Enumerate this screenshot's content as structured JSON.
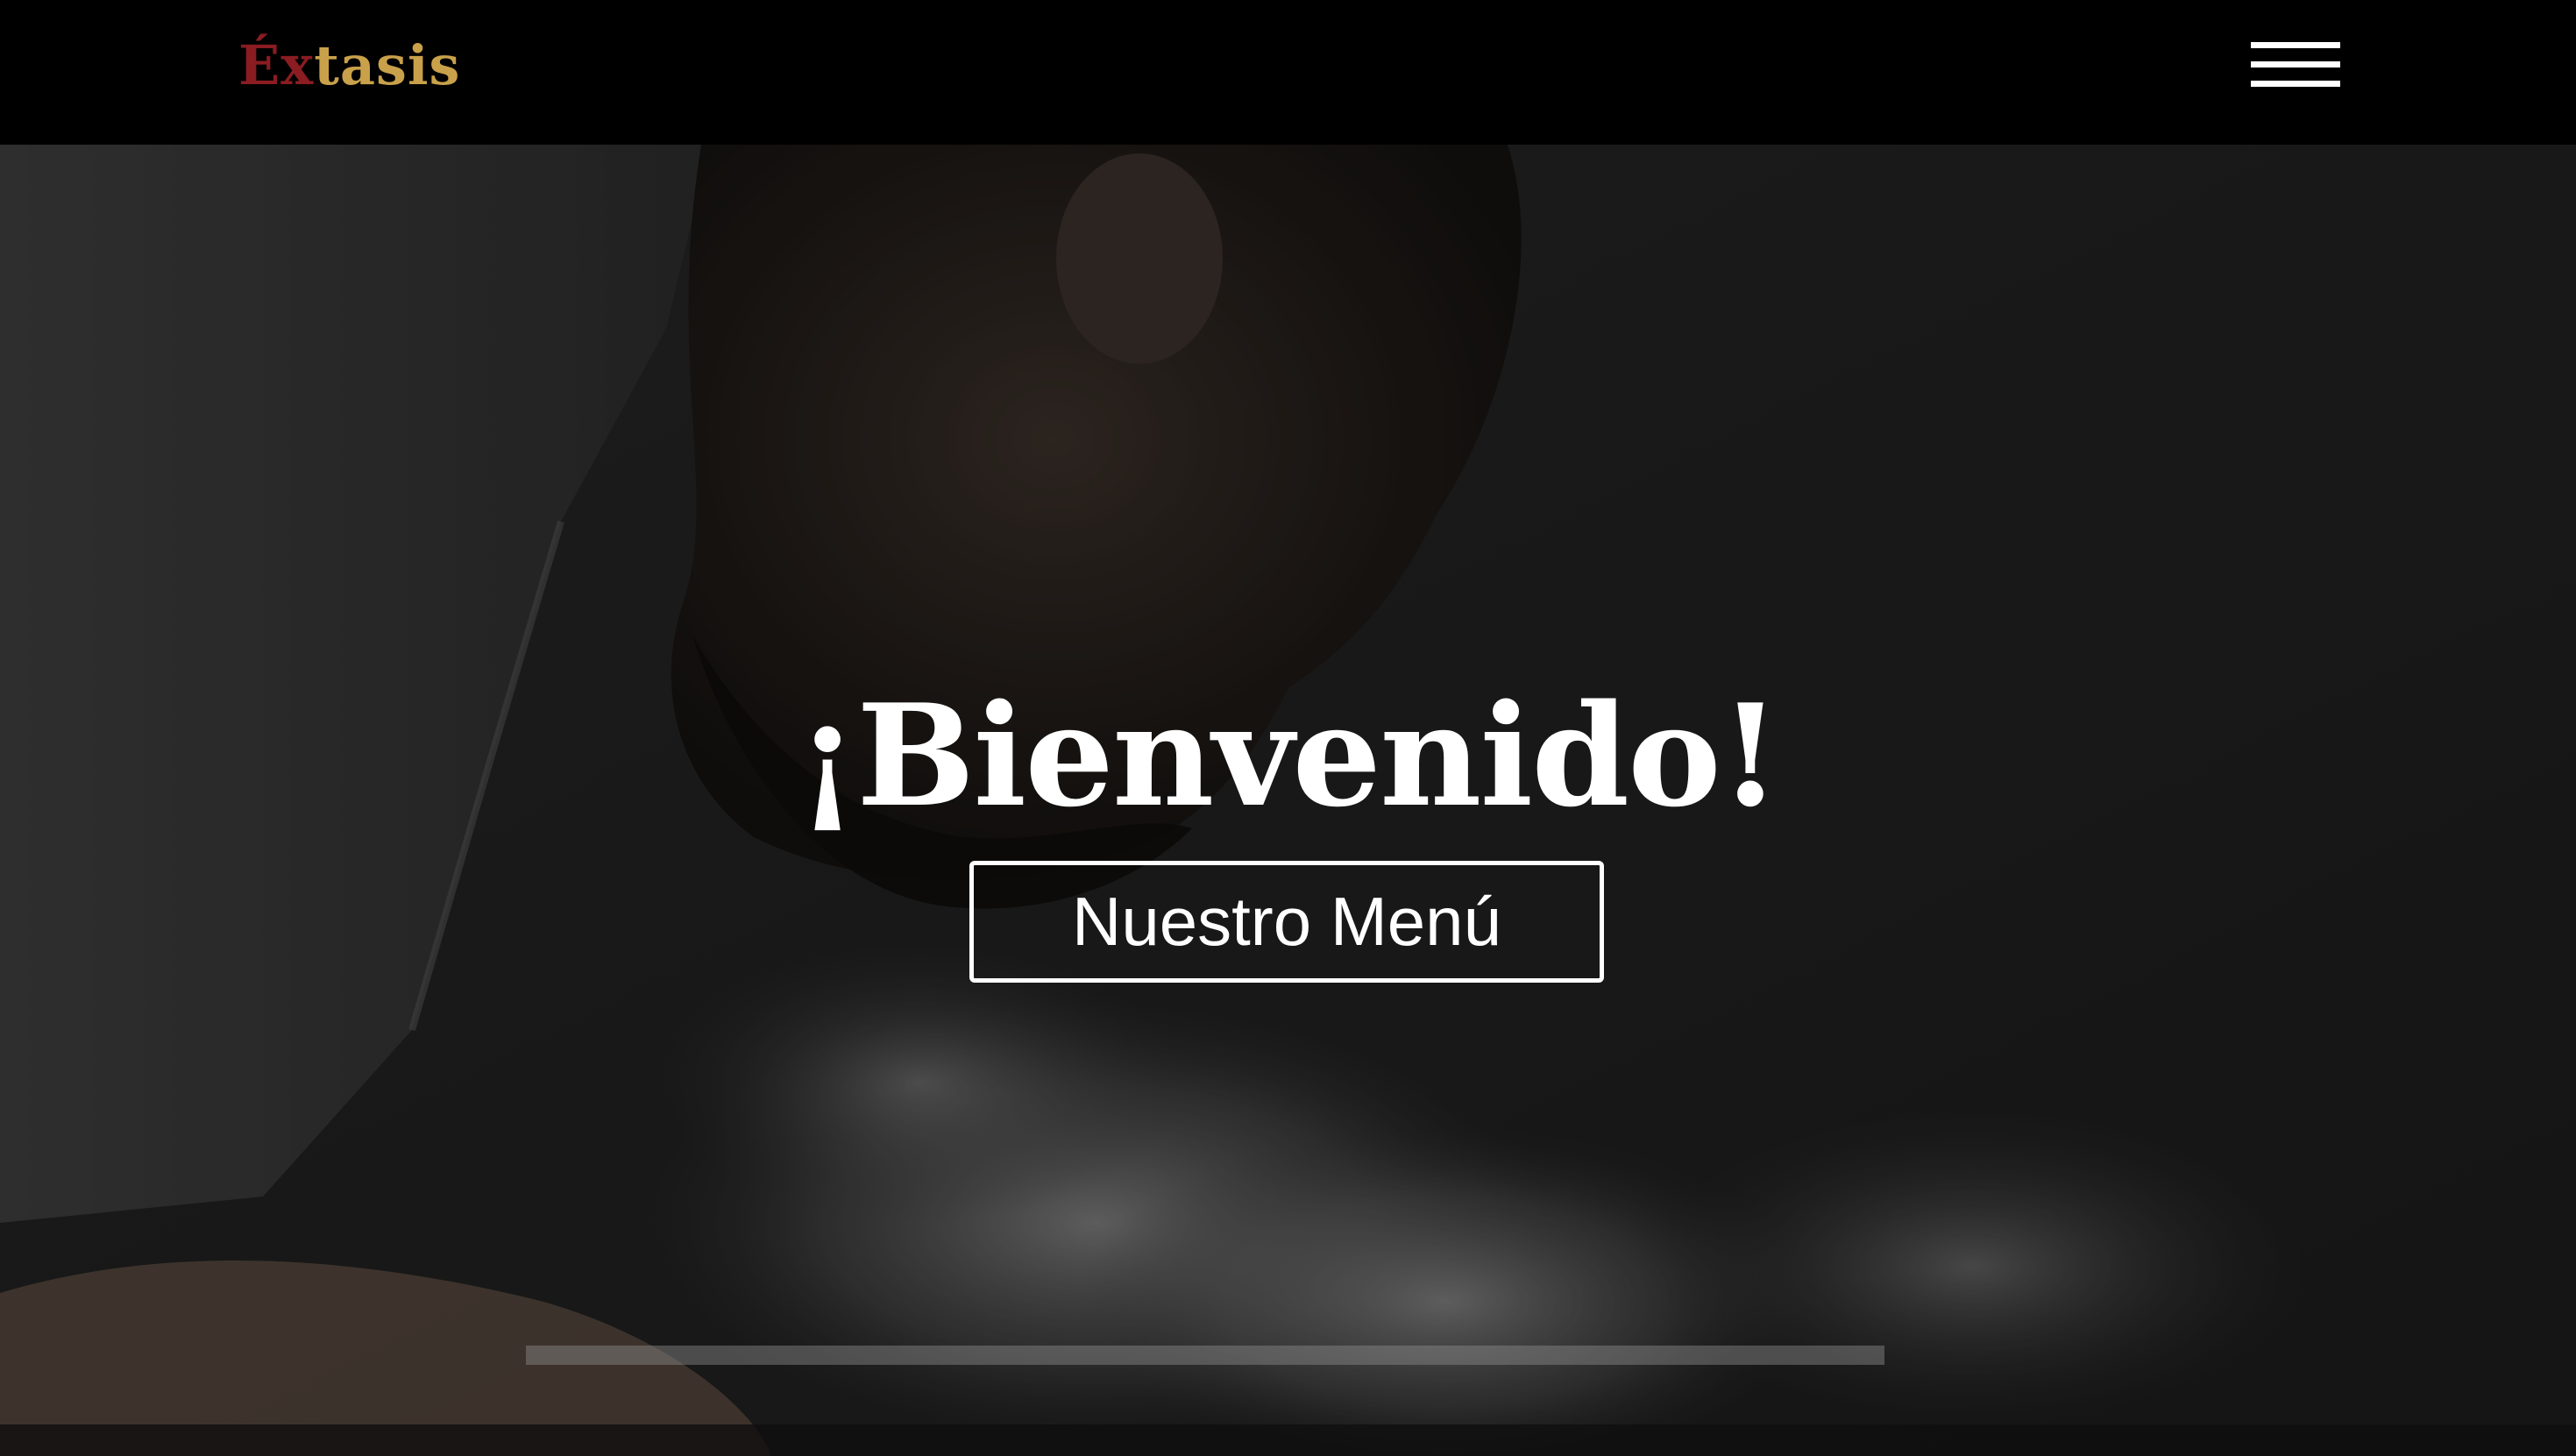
{
  "header": {
    "logo_prefix": "Éx",
    "logo_suffix": "tasis",
    "menu_icon": "hamburger-menu-icon"
  },
  "hero": {
    "title": "¡Bienvenido!",
    "button_label": "Nuestro Menú",
    "background": "chef-cooking-photo"
  },
  "colors": {
    "logo_primary": "#8a1c22",
    "logo_secondary": "#c9a14a",
    "navbar_bg": "#000000",
    "text": "#ffffff"
  }
}
